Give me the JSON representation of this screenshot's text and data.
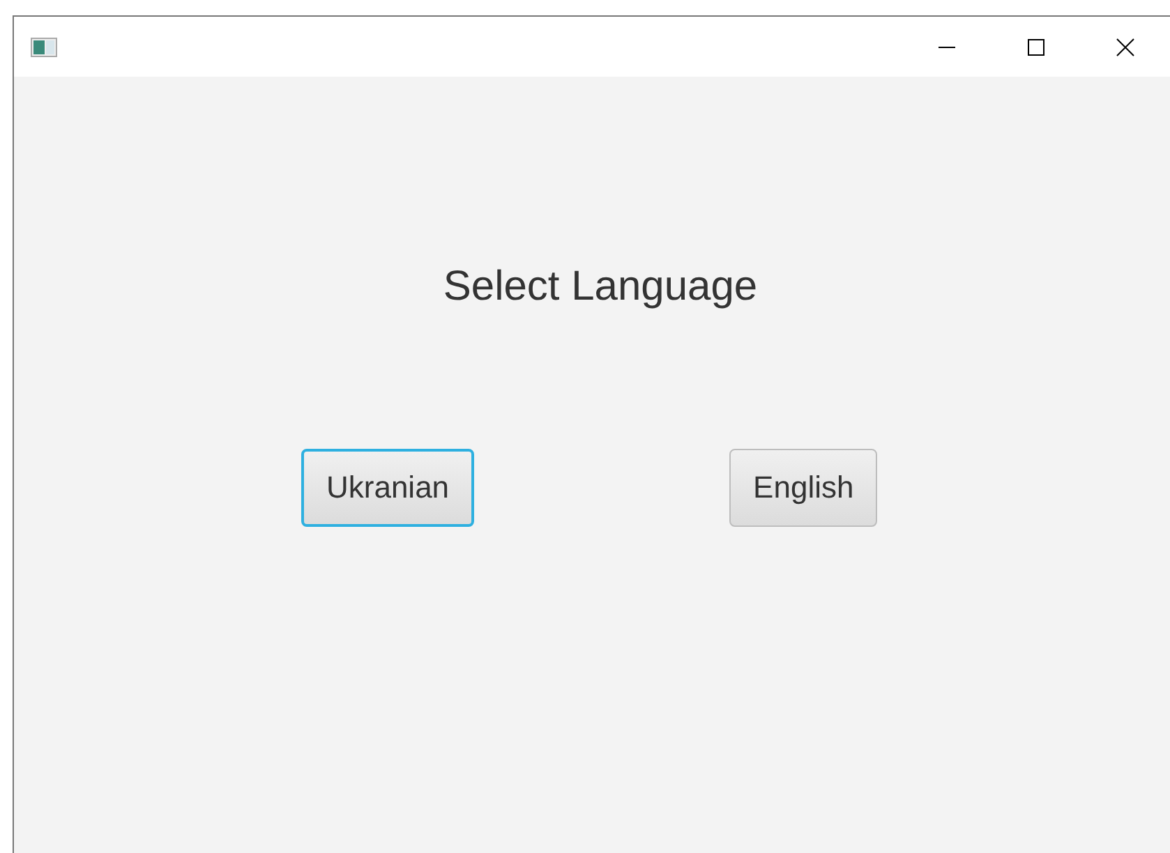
{
  "window": {
    "controls": [
      {
        "kind": "minimize"
      },
      {
        "kind": "maximize"
      },
      {
        "kind": "close"
      }
    ]
  },
  "heading": "Select Language",
  "buttons": [
    {
      "label": "Ukranian",
      "focused": true
    },
    {
      "label": "English",
      "focused": false
    }
  ]
}
